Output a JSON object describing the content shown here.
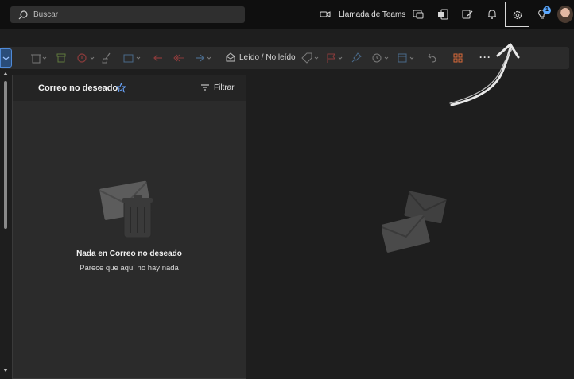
{
  "search": {
    "placeholder": "Buscar"
  },
  "header": {
    "teams_call_label": "Llamada de Teams",
    "notification_badge": "1"
  },
  "toolbar": {
    "read_unread_label": "Leído / No leído",
    "more_label": "···"
  },
  "folder": {
    "title": "Correo no deseado",
    "filter_label": "Filtrar"
  },
  "empty_state": {
    "title": "Nada en Correo no deseado",
    "subtitle": "Parece que aquí no hay nada"
  },
  "colors": {
    "accent": "#4f8ad8",
    "badge": "#5aa8ff",
    "topbar_bg": "#0f0f0f",
    "pane_bg": "#2b2b2b"
  }
}
